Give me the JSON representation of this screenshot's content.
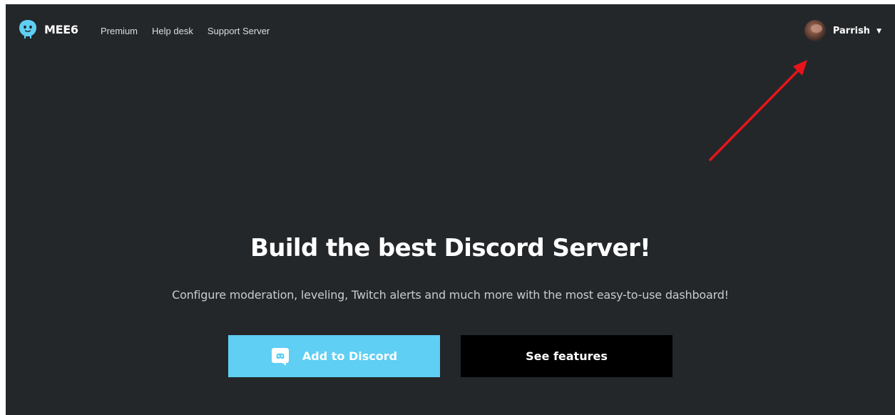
{
  "brand": {
    "name": "MEE6",
    "logo_icon": "mee6-mascot-icon",
    "logo_color": "#5fcff3"
  },
  "nav": {
    "items": [
      {
        "label": "Premium"
      },
      {
        "label": "Help desk"
      },
      {
        "label": "Support Server"
      }
    ]
  },
  "user": {
    "name": "Parrish",
    "avatar_icon": "user-avatar",
    "menu_icon": "caret-down-icon",
    "caret_glyph": "▼"
  },
  "hero": {
    "title": "Build the best Discord Server!",
    "subtitle": "Configure moderation, leveling, Twitch alerts and much more with the most easy-to-use dashboard!"
  },
  "actions": {
    "add_to_discord": {
      "label": "Add to Discord",
      "icon": "discord-icon",
      "color": "#5fcff3"
    },
    "see_features": {
      "label": "See features",
      "color": "#000000"
    }
  },
  "annotation": {
    "type": "red-arrow",
    "points_to": "user-menu",
    "color": "#e8141a"
  },
  "theme": {
    "background": "#23272a",
    "text": "#ffffff"
  }
}
